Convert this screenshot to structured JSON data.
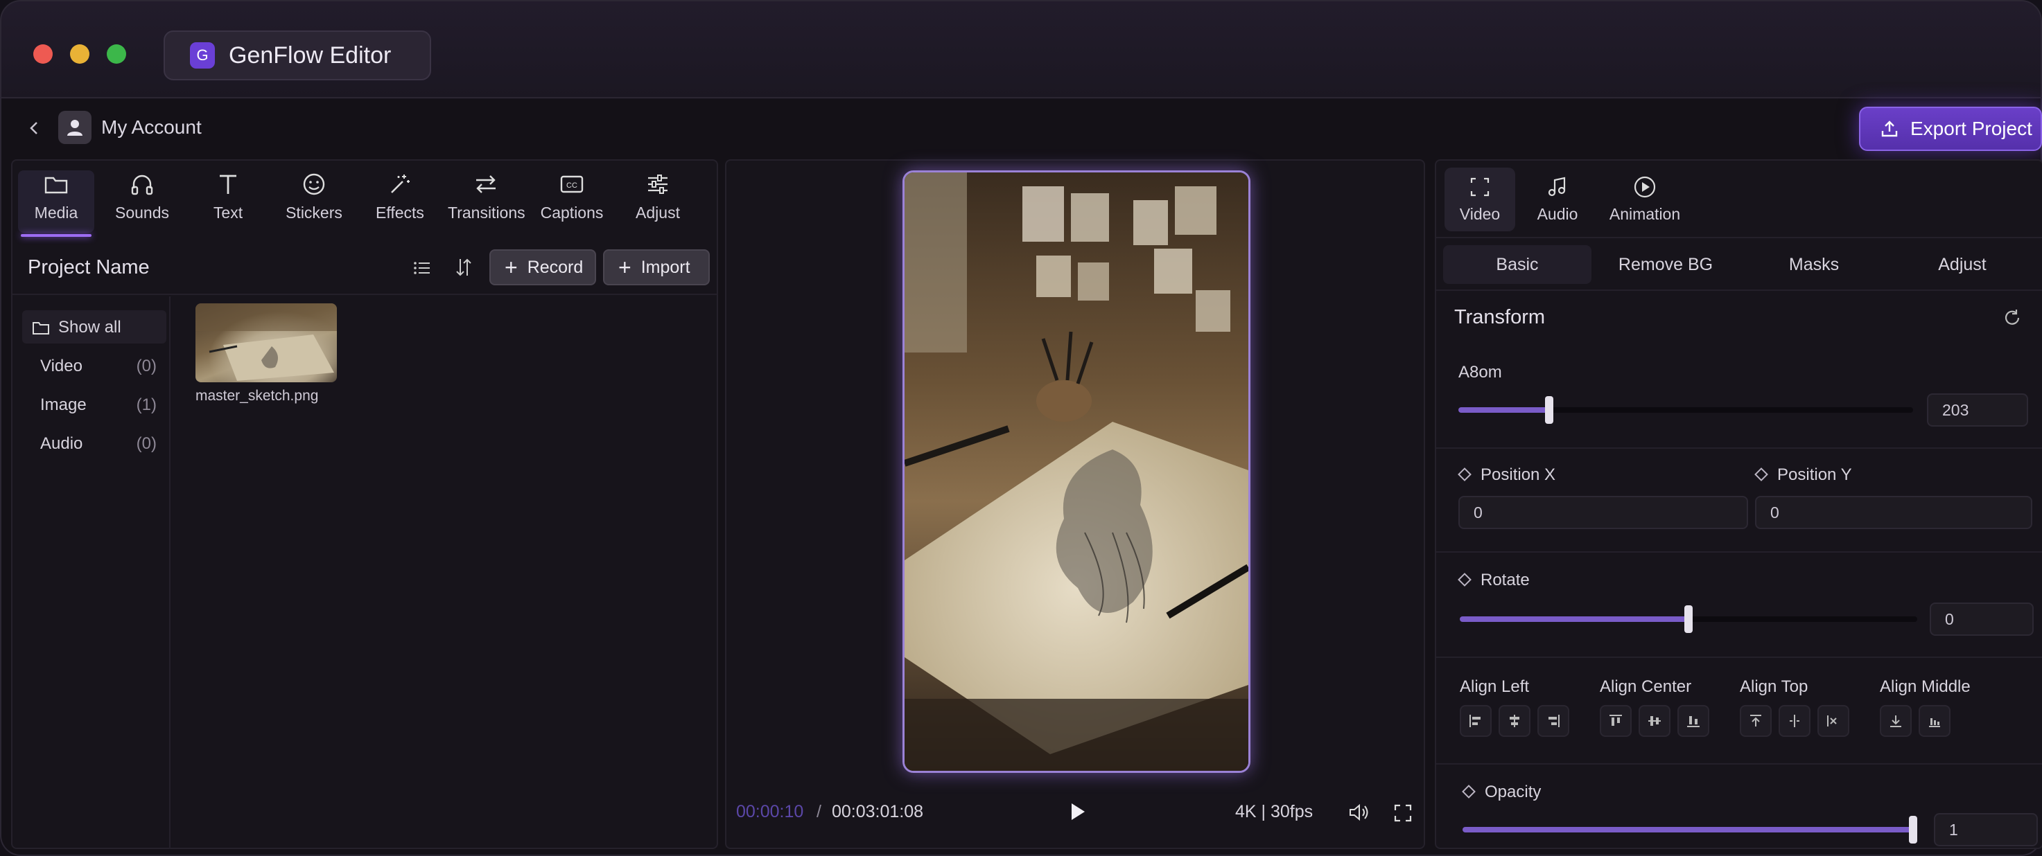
{
  "app": {
    "badge": "G",
    "title": "GenFlow Editor"
  },
  "account": {
    "label": "My Account"
  },
  "export": {
    "label": "Export Project"
  },
  "tools": [
    {
      "label": "Media",
      "icon": "folder-icon"
    },
    {
      "label": "Sounds",
      "icon": "headphones-icon"
    },
    {
      "label": "Text",
      "icon": "text-icon"
    },
    {
      "label": "Stickers",
      "icon": "smiley-icon"
    },
    {
      "label": "Effects",
      "icon": "magic-wand-icon"
    },
    {
      "label": "Transitions",
      "icon": "swap-arrows-icon"
    },
    {
      "label": "Captions",
      "icon": "cc-icon"
    },
    {
      "label": "Adjust",
      "icon": "sliders-icon"
    }
  ],
  "project": {
    "name": "Project Name",
    "record_label": "Record",
    "import_label": "Import"
  },
  "media_filters": [
    {
      "label": "Show all",
      "count": ""
    },
    {
      "label": "Video",
      "count": "(0)"
    },
    {
      "label": "Image",
      "count": "(1)"
    },
    {
      "label": "Audio",
      "count": "(0)"
    }
  ],
  "media_items": [
    {
      "filename": "master_sketch.png"
    }
  ],
  "preview": {
    "current_time": "00:00:10",
    "separator": "/",
    "total_time": "00:03:01:08",
    "quality": "4K | 30fps"
  },
  "right_tabs": [
    {
      "label": "Video",
      "icon": "crop-frame-icon"
    },
    {
      "label": "Audio",
      "icon": "music-note-icon"
    },
    {
      "label": "Animation",
      "icon": "play-circle-icon"
    }
  ],
  "sub_tabs": [
    "Basic",
    "Remove BG",
    "Masks",
    "Adjust"
  ],
  "transform": {
    "title": "Transform",
    "zoom": {
      "label": "A8om",
      "value": "203",
      "level": 0.2
    },
    "position_x": {
      "label": "Position X",
      "value": "0"
    },
    "position_y": {
      "label": "Position Y",
      "value": "0"
    },
    "rotate": {
      "label": "Rotate",
      "value": "0",
      "level": 0.5
    },
    "align_groups": [
      "Align Left",
      "Align Center",
      "Align Top",
      "Align Middle"
    ],
    "opacity": {
      "label": "Opacity",
      "value": "1",
      "level": 1.0
    }
  },
  "colors": {
    "accent": "#7a5cc8",
    "export_bg": "#6a3fc8",
    "time_current": "#5b47a8"
  }
}
